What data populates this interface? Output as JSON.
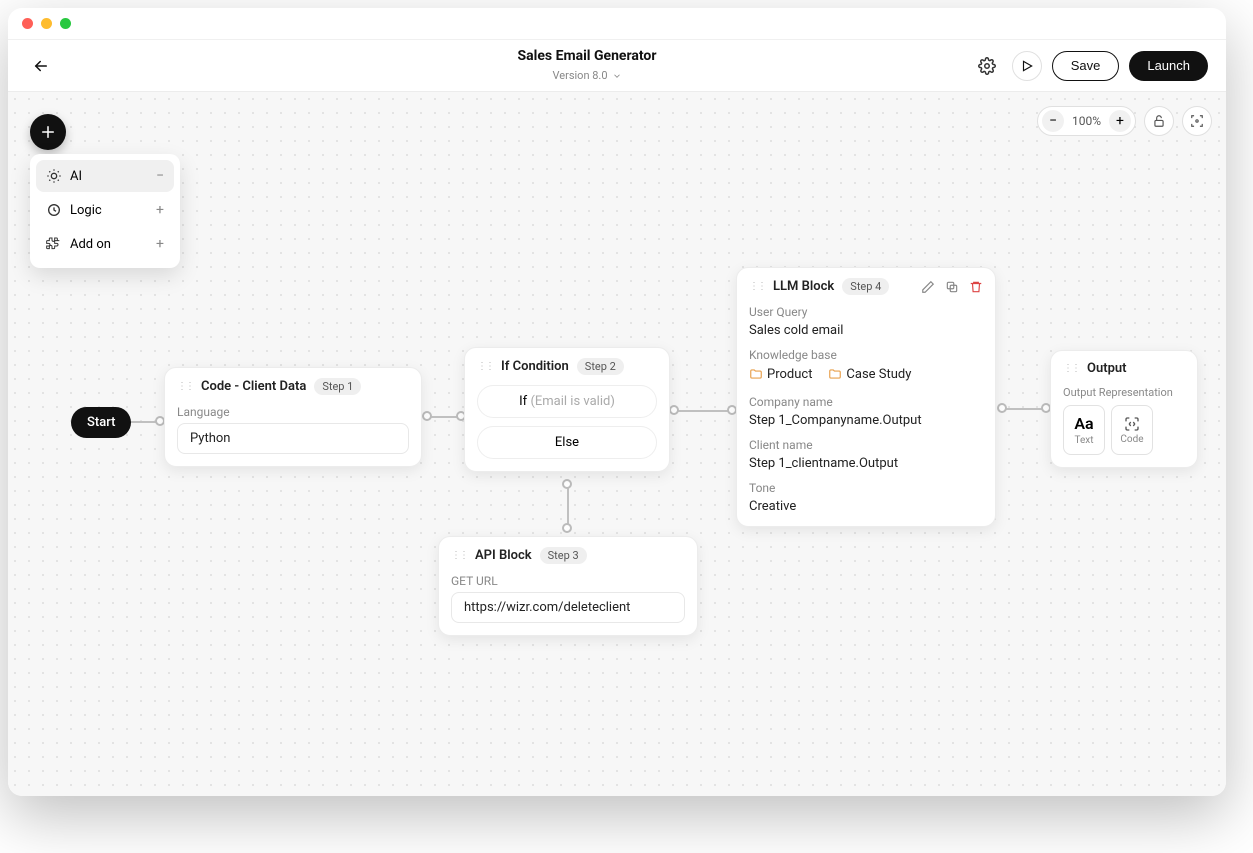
{
  "header": {
    "title": "Sales Email Generator",
    "version": "Version 8.0",
    "save": "Save",
    "launch": "Launch"
  },
  "zoom": "100%",
  "menu": {
    "items": [
      {
        "label": "AI",
        "expanded": true
      },
      {
        "label": "Logic",
        "expanded": false
      },
      {
        "label": "Add on",
        "expanded": false
      }
    ]
  },
  "start": {
    "label": "Start"
  },
  "codeNode": {
    "title": "Code - Client Data",
    "step": "Step 1",
    "languageLabel": "Language",
    "languageValue": "Python"
  },
  "ifNode": {
    "title": "If Condition",
    "step": "Step 2",
    "ifLabel": "If",
    "ifHint": "(Email is valid)",
    "elseLabel": "Else"
  },
  "apiNode": {
    "title": "API Block",
    "step": "Step 3",
    "urlLabel": "GET URL",
    "urlValue": "https://wizr.com/deleteclient"
  },
  "llmNode": {
    "title": "LLM Block",
    "step": "Step 4",
    "userQueryLabel": "User Query",
    "userQueryValue": "Sales cold email",
    "kbLabel": "Knowledge base",
    "kbItems": [
      "Product",
      "Case Study"
    ],
    "companyLabel": "Company name",
    "companyValue": "Step 1_Companyname.Output",
    "clientLabel": "Client name",
    "clientValue": "Step 1_clientname.Output",
    "toneLabel": "Tone",
    "toneValue": "Creative"
  },
  "outputNode": {
    "title": "Output",
    "repLabel": "Output Representation",
    "text": "Text",
    "textGlyph": "Aa",
    "code": "Code"
  }
}
